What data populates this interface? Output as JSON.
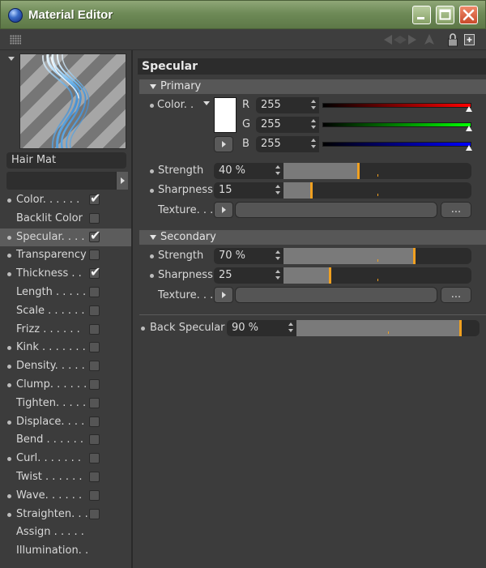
{
  "window": {
    "title": "Material Editor",
    "controls": [
      "minimize-icon",
      "maximize-icon",
      "close-icon"
    ]
  },
  "toolbar": {
    "icons": [
      "grip-icon",
      "nav-arrows-icon",
      "pointer-icon",
      "lock-icon",
      "new-window-icon"
    ]
  },
  "material": {
    "name": "Hair Mat",
    "preview": "hair-preview-thumbnail"
  },
  "channels": [
    {
      "label": "Color. . . . . .",
      "checked": true,
      "bullet": true,
      "active": false
    },
    {
      "label": "Backlit Color",
      "checked": false,
      "bullet": false,
      "active": false
    },
    {
      "label": "Specular. . . .",
      "checked": true,
      "bullet": true,
      "active": true
    },
    {
      "label": "Transparency",
      "checked": false,
      "bullet": true,
      "active": false
    },
    {
      "label": "Thickness . .",
      "checked": true,
      "bullet": true,
      "active": false
    },
    {
      "label": "Length . . . . .",
      "checked": false,
      "bullet": false,
      "active": false
    },
    {
      "label": "Scale . . . . . .",
      "checked": false,
      "bullet": false,
      "active": false
    },
    {
      "label": "Frizz . . . . . .",
      "checked": false,
      "bullet": false,
      "active": false
    },
    {
      "label": "Kink . . . . . . .",
      "checked": false,
      "bullet": true,
      "active": false
    },
    {
      "label": "Density. . . . .",
      "checked": false,
      "bullet": true,
      "active": false
    },
    {
      "label": "Clump. . . . . .",
      "checked": false,
      "bullet": true,
      "active": false
    },
    {
      "label": "Tighten. . . . .",
      "checked": false,
      "bullet": false,
      "active": false
    },
    {
      "label": "Displace. . . .",
      "checked": false,
      "bullet": true,
      "active": false
    },
    {
      "label": "Bend . . . . . .",
      "checked": false,
      "bullet": false,
      "active": false
    },
    {
      "label": "Curl. . . . . . .",
      "checked": false,
      "bullet": true,
      "active": false
    },
    {
      "label": "Twist . . . . . .",
      "checked": false,
      "bullet": false,
      "active": false
    },
    {
      "label": "Wave. . . . . .",
      "checked": false,
      "bullet": true,
      "active": false
    },
    {
      "label": "Straighten. . .",
      "checked": false,
      "bullet": true,
      "active": false
    },
    {
      "label": "Assign . . . . .",
      "checked": null,
      "bullet": false,
      "active": false
    },
    {
      "label": "Illumination. .",
      "checked": null,
      "bullet": false,
      "active": false
    }
  ],
  "specular": {
    "title": "Specular",
    "primary": {
      "title": "Primary",
      "color_label": "Color. .",
      "swatch_color": "#ffffff",
      "r_label": "R",
      "r_value": "255",
      "g_label": "G",
      "g_value": "255",
      "b_label": "B",
      "b_value": "255",
      "strength_label": "Strength",
      "strength_value": "40 %",
      "strength_fraction": 0.4,
      "sharpness_label": "Sharpness",
      "sharpness_value": "15",
      "sharpness_fraction": 0.15,
      "texture_label": "Texture. . .",
      "texture_button": "..."
    },
    "secondary": {
      "title": "Secondary",
      "strength_label": "Strength",
      "strength_value": "70 %",
      "strength_fraction": 0.7,
      "sharpness_label": "Sharpness",
      "sharpness_value": "25",
      "sharpness_fraction": 0.25,
      "texture_label": "Texture. . .",
      "texture_button": "..."
    },
    "back_specular_label": "Back Specular",
    "back_specular_value": "90 %",
    "back_specular_fraction": 0.9
  },
  "colors": {
    "titlebar": "#6e8a57",
    "panel_bg": "#3c3c3c",
    "field_bg": "#2c2c2c",
    "slider_fill": "#7a7a7a",
    "accent": "#f0a020",
    "red_channel": "#ff0000",
    "green_channel": "#00ff00",
    "blue_channel": "#0000ff"
  }
}
